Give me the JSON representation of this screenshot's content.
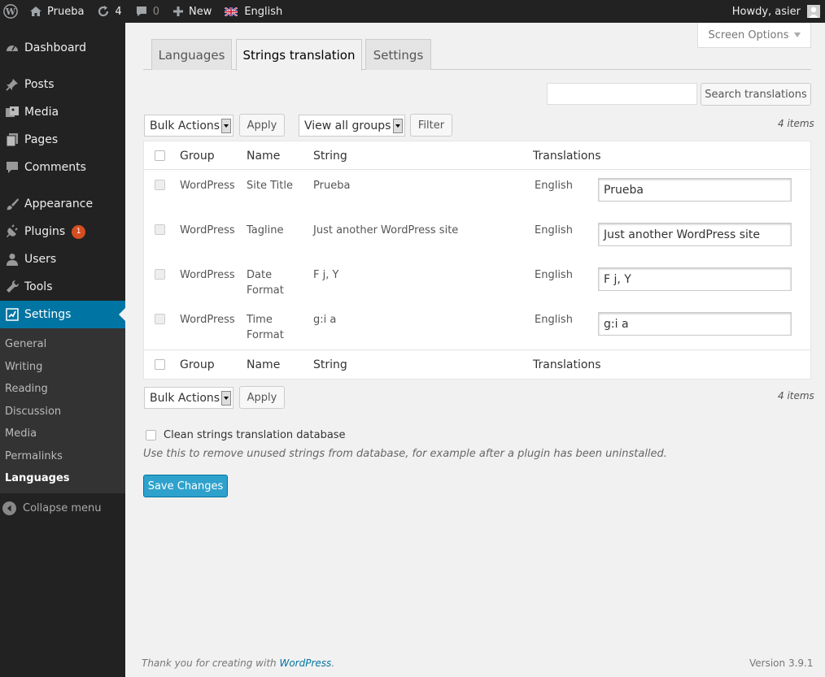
{
  "adminbar": {
    "site_name": "Prueba",
    "updates_count": "4",
    "comments_count": "0",
    "new_label": "New",
    "language_label": "English",
    "howdy": "Howdy, asier"
  },
  "sidebar": {
    "items": [
      {
        "label": "Dashboard",
        "icon": "dashboard-icon"
      },
      {
        "label": "Posts",
        "icon": "pin-icon"
      },
      {
        "label": "Media",
        "icon": "media-icon"
      },
      {
        "label": "Pages",
        "icon": "pages-icon"
      },
      {
        "label": "Comments",
        "icon": "comment-icon"
      },
      {
        "label": "Appearance",
        "icon": "brush-icon"
      },
      {
        "label": "Plugins",
        "icon": "plugin-icon",
        "badge": "1"
      },
      {
        "label": "Users",
        "icon": "user-icon"
      },
      {
        "label": "Tools",
        "icon": "wrench-icon"
      },
      {
        "label": "Settings",
        "icon": "settings-icon"
      }
    ],
    "submenu": [
      "General",
      "Writing",
      "Reading",
      "Discussion",
      "Media",
      "Permalinks",
      "Languages"
    ],
    "collapse_label": "Collapse menu"
  },
  "screen_options": "Screen Options",
  "tabs": [
    "Languages",
    "Strings translation",
    "Settings"
  ],
  "search": {
    "button": "Search translations",
    "value": ""
  },
  "top_controls": {
    "bulk_actions": "Bulk Actions",
    "apply": "Apply",
    "group_filter": "View all groups",
    "filter": "Filter",
    "items_count": "4 items"
  },
  "table": {
    "columns": [
      "Group",
      "Name",
      "String",
      "Translations"
    ],
    "rows": [
      {
        "group": "WordPress",
        "name": "Site Title",
        "string": "Prueba",
        "lang": "English",
        "translation": "Prueba"
      },
      {
        "group": "WordPress",
        "name": "Tagline",
        "string": "Just another WordPress site",
        "lang": "English",
        "translation": "Just another WordPress site"
      },
      {
        "group": "WordPress",
        "name": "Date Format",
        "string": "F j, Y",
        "lang": "English",
        "translation": "F j, Y"
      },
      {
        "group": "WordPress",
        "name": "Time Format",
        "string": "g:i a",
        "lang": "English",
        "translation": "g:i a"
      }
    ]
  },
  "bottom_controls": {
    "bulk_actions": "Bulk Actions",
    "apply": "Apply",
    "items_count": "4 items"
  },
  "clean": {
    "label": "Clean strings translation database",
    "description": "Use this to remove unused strings from database, for example after a plugin has been uninstalled."
  },
  "save_button": "Save Changes",
  "footer": {
    "thanks": "Thank you for creating with",
    "wp_link": "WordPress",
    "period": ".",
    "version": "Version 3.9.1"
  },
  "colors": {
    "adminbar_bg": "#222222",
    "current_menu": "#0074a2",
    "primary_button": "#2ea2cc",
    "badge": "#d54e21"
  }
}
